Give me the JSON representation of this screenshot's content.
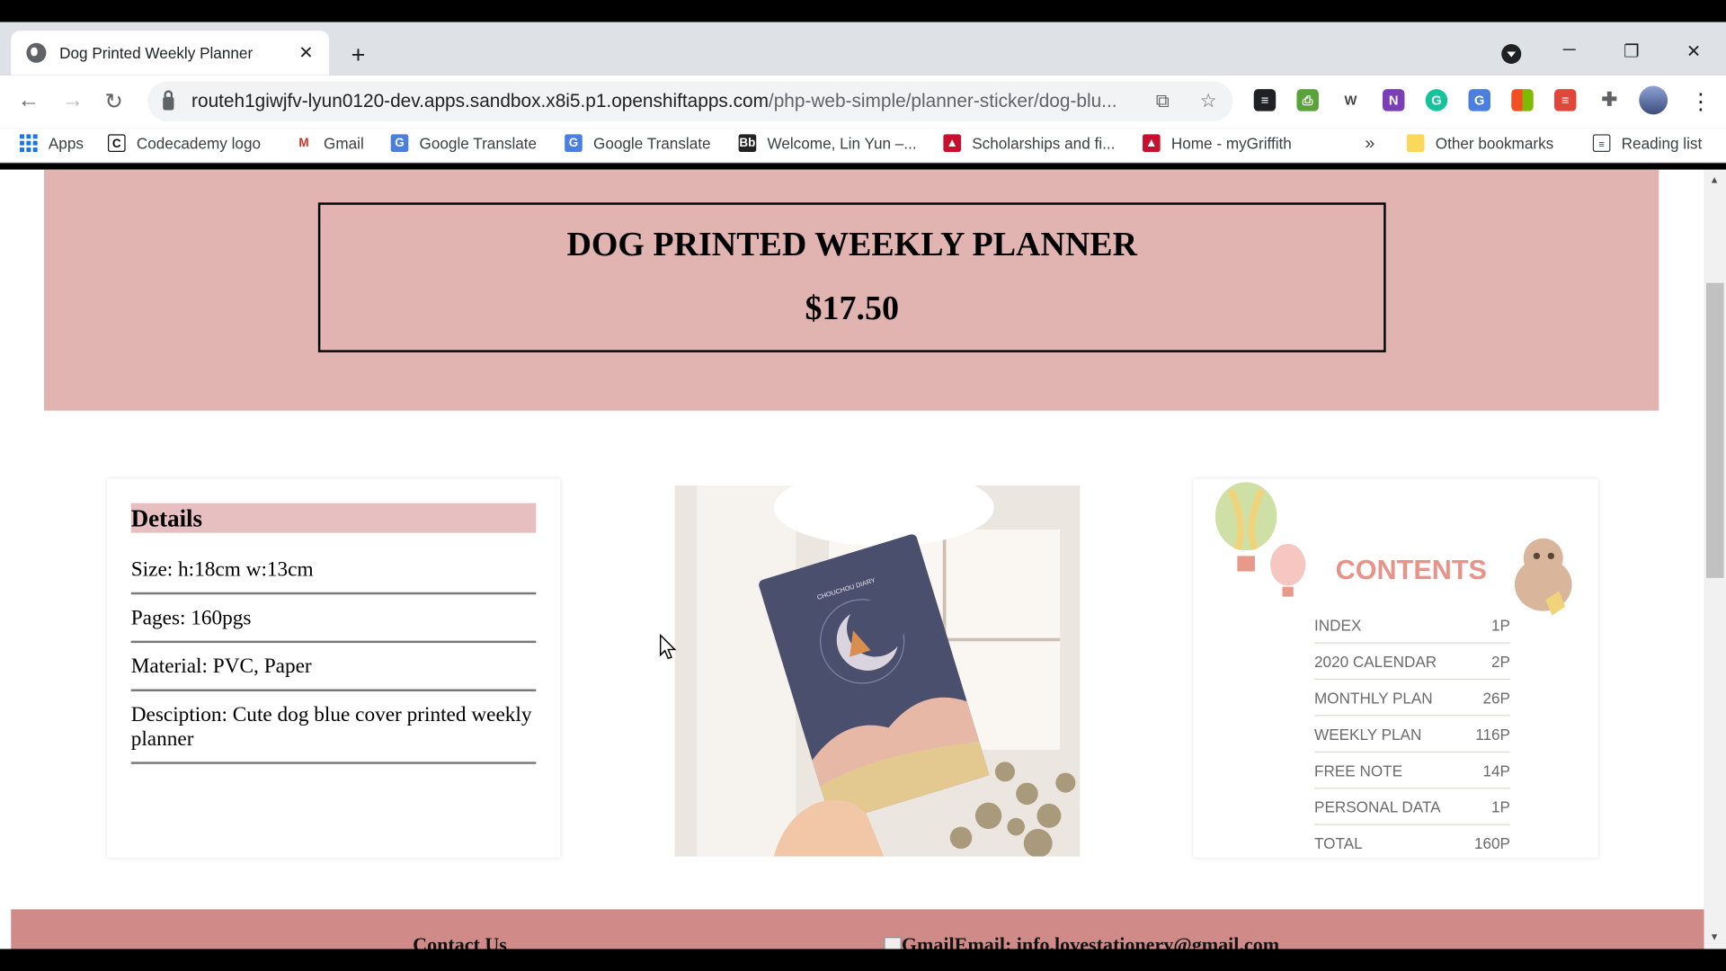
{
  "browser": {
    "tab_title": "Dog Printed Weekly Planner",
    "new_tab_label": "+",
    "url_host": "routeh1giwjfv-lyun0120-dev.apps.sandbox.x8i5.p1.openshiftapps.com",
    "url_path": "/php-web-simple/planner-sticker/dog-blu..."
  },
  "bookmarks": {
    "items": [
      {
        "label": "Apps",
        "icon": "apps-grid-icon"
      },
      {
        "label": "Codecademy logo",
        "icon": "codecademy-icon"
      },
      {
        "label": "Gmail",
        "icon": "gmail-icon"
      },
      {
        "label": "Google Translate",
        "icon": "google-translate-icon"
      },
      {
        "label": "Google Translate",
        "icon": "google-translate-icon"
      },
      {
        "label": "Welcome, Lin Yun –...",
        "icon": "blackboard-icon"
      },
      {
        "label": "Scholarships and fi...",
        "icon": "griffith-icon"
      },
      {
        "label": "Home - myGriffith",
        "icon": "griffith-icon"
      }
    ],
    "overflow": "»",
    "other": "Other bookmarks",
    "reading_list": "Reading list"
  },
  "product": {
    "title": "DOG PRINTED WEEKLY PLANNER",
    "price": "$17.50"
  },
  "details": {
    "heading": "Details",
    "rows": [
      "Size: h:18cm w:13cm",
      "Pages: 160pgs",
      "Material: PVC, Paper",
      "Desciption: Cute dog blue cover printed weekly planner"
    ]
  },
  "contents": {
    "heading": "CONTENTS",
    "rows": [
      {
        "name": "INDEX",
        "pages": "1P"
      },
      {
        "name": "2020 CALENDAR",
        "pages": "2P"
      },
      {
        "name": "MONTHLY PLAN",
        "pages": "26P"
      },
      {
        "name": "WEEKLY PLAN",
        "pages": "116P"
      },
      {
        "name": "FREE NOTE",
        "pages": "14P"
      },
      {
        "name": "PERSONAL DATA",
        "pages": "1P"
      },
      {
        "name": "TOTAL",
        "pages": "160P"
      }
    ]
  },
  "photo": {
    "cover_text": "CHOUCHOU DIARY"
  },
  "footer": {
    "contact": "Contact Us",
    "email": "GmailEmail: info.lovestationery@gmail.com"
  },
  "colors": {
    "hero": "#e1b4b1",
    "footer": "#d08a88",
    "details_heading": "#e8bfc0",
    "contents_heading": "#e8938a"
  }
}
